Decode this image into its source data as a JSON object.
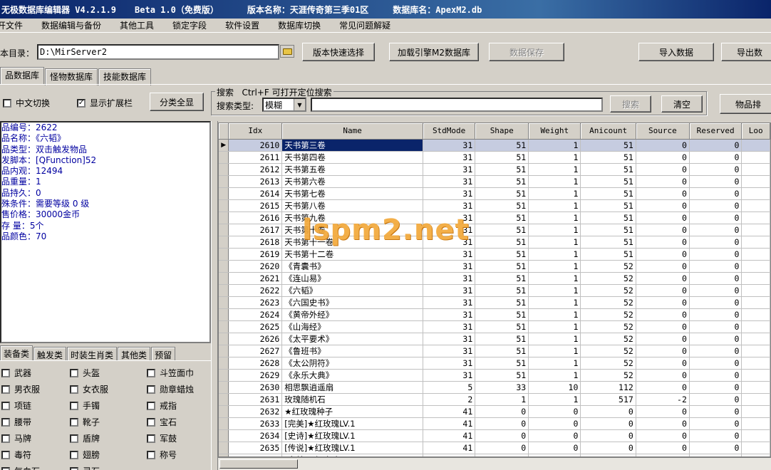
{
  "titlebar": {
    "app": "无极数据库编辑器 V4.2.1.9",
    "edition": "Beta 1.0（免费版）",
    "version_label": "版本名称：天涯传奇第三季01区",
    "db_label": "数据库名：ApexM2.db"
  },
  "menu": [
    "开文件",
    "数据编辑与备份",
    "其他工具",
    "锁定字段",
    "软件设置",
    "数据库切换",
    "常见问题解疑"
  ],
  "pathbar": {
    "label": "本目录：",
    "value": "D:\\MirServer2",
    "btn_quick": "版本快速选择",
    "btn_load": "加载引擎M2数据库",
    "btn_save": "数据保存",
    "btn_import": "导入数据",
    "btn_export": "导出数"
  },
  "tabs": [
    "品数据库",
    "怪物数据库",
    "技能数据库"
  ],
  "options": {
    "cn_switch": "中文切换",
    "show_ext": "显示扩展栏",
    "btn_all": "分类全显"
  },
  "search": {
    "title": "搜索   Ctrl+F 可打开定位搜索",
    "type_label": "搜索类型:",
    "type_value": "模糊",
    "query": "",
    "btn_search": "搜索",
    "btn_clear": "清空",
    "btn_sort": "物品排"
  },
  "info": [
    "品编号：2622",
    "品名称：《六韬》",
    "品类型：双击触发物品",
    "发脚本：[QFunction]52",
    "品内观：12494",
    "品重量：1",
    "品持久：0",
    "殊条件：需要等级 0 级",
    "售价格：30000金币",
    "存 量：5个",
    "品颜色：70"
  ],
  "bottom_tabs": [
    "装备类",
    "触发类",
    "时装生肖类",
    "其他类",
    "预留"
  ],
  "categories": [
    [
      "武器",
      "头盔",
      "斗笠面巾"
    ],
    [
      "男衣服",
      "女衣服",
      "勋章蜡烛"
    ],
    [
      "项链",
      "手镯",
      "戒指"
    ],
    [
      "腰带",
      "靴子",
      "宝石"
    ],
    [
      "马牌",
      "盾牌",
      "军鼓"
    ],
    [
      "毒符",
      "翅膀",
      "称号"
    ],
    [
      "气血石",
      "灵石",
      ""
    ]
  ],
  "table": {
    "columns": [
      "Idx",
      "Name",
      "StdMode",
      "Shape",
      "Weight",
      "Anicount",
      "Source",
      "Reserved",
      "Loo"
    ],
    "rows": [
      [
        "2610",
        "天书第三卷",
        "31",
        "51",
        "1",
        "51",
        "0",
        "0"
      ],
      [
        "2611",
        "天书第四卷",
        "31",
        "51",
        "1",
        "51",
        "0",
        "0"
      ],
      [
        "2612",
        "天书第五卷",
        "31",
        "51",
        "1",
        "51",
        "0",
        "0"
      ],
      [
        "2613",
        "天书第六卷",
        "31",
        "51",
        "1",
        "51",
        "0",
        "0"
      ],
      [
        "2614",
        "天书第七卷",
        "31",
        "51",
        "1",
        "51",
        "0",
        "0"
      ],
      [
        "2615",
        "天书第八卷",
        "31",
        "51",
        "1",
        "51",
        "0",
        "0"
      ],
      [
        "2616",
        "天书第九卷",
        "31",
        "51",
        "1",
        "51",
        "0",
        "0"
      ],
      [
        "2617",
        "天书第十卷",
        "31",
        "51",
        "1",
        "51",
        "0",
        "0"
      ],
      [
        "2618",
        "天书第十一卷",
        "31",
        "51",
        "1",
        "51",
        "0",
        "0"
      ],
      [
        "2619",
        "天书第十二卷",
        "31",
        "51",
        "1",
        "51",
        "0",
        "0"
      ],
      [
        "2620",
        "《青囊书》",
        "31",
        "51",
        "1",
        "52",
        "0",
        "0"
      ],
      [
        "2621",
        "《连山易》",
        "31",
        "51",
        "1",
        "52",
        "0",
        "0"
      ],
      [
        "2622",
        "《六韬》",
        "31",
        "51",
        "1",
        "52",
        "0",
        "0"
      ],
      [
        "2623",
        "《六国史书》",
        "31",
        "51",
        "1",
        "52",
        "0",
        "0"
      ],
      [
        "2624",
        "《黄帝外经》",
        "31",
        "51",
        "1",
        "52",
        "0",
        "0"
      ],
      [
        "2625",
        "《山海经》",
        "31",
        "51",
        "1",
        "52",
        "0",
        "0"
      ],
      [
        "2626",
        "《太平要术》",
        "31",
        "51",
        "1",
        "52",
        "0",
        "0"
      ],
      [
        "2627",
        "《鲁班书》",
        "31",
        "51",
        "1",
        "52",
        "0",
        "0"
      ],
      [
        "2628",
        "《太公阴符》",
        "31",
        "51",
        "1",
        "52",
        "0",
        "0"
      ],
      [
        "2629",
        "《永乐大典》",
        "31",
        "51",
        "1",
        "52",
        "0",
        "0"
      ],
      [
        "2630",
        "相思飘逍遥扇",
        "5",
        "33",
        "10",
        "112",
        "0",
        "0"
      ],
      [
        "2631",
        "玫瑰随机石",
        "2",
        "1",
        "1",
        "517",
        "-2",
        "0"
      ],
      [
        "2632",
        "★红玫瑰种子",
        "41",
        "0",
        "0",
        "0",
        "0",
        "0"
      ],
      [
        "2633",
        "[完美]★红玫瑰LV.1",
        "41",
        "0",
        "0",
        "0",
        "0",
        "0"
      ],
      [
        "2634",
        "[史诗]★红玫瑰LV.1",
        "41",
        "0",
        "0",
        "0",
        "0",
        "0"
      ],
      [
        "2635",
        "[传说]★红玫瑰LV.1",
        "41",
        "0",
        "0",
        "0",
        "0",
        "0"
      ],
      [
        "2636",
        "[完美]★红玫瑰LV.2",
        "41",
        "0",
        "0",
        "0",
        "0",
        "0"
      ]
    ],
    "selected_index": 0
  },
  "watermark": "lspm2.net"
}
